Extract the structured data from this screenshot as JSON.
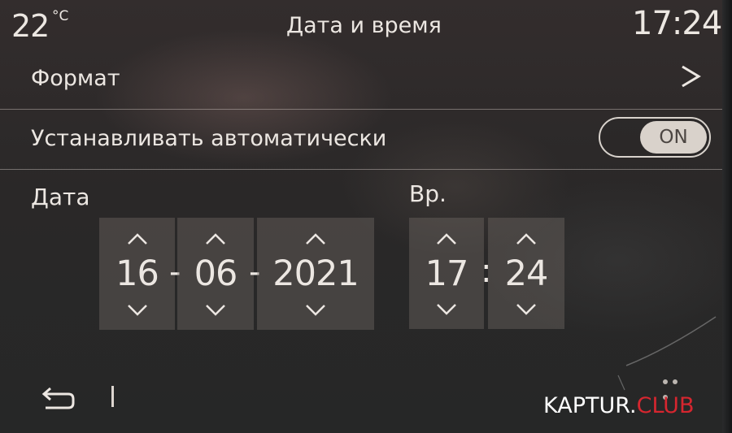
{
  "status": {
    "temperature": "22",
    "temperature_unit": "°C",
    "title": "Дата и время",
    "clock": "17:24"
  },
  "settings": {
    "format_label": "Формат",
    "auto_label": "Устанавливать автоматически",
    "auto_toggle": "ON"
  },
  "date": {
    "label": "Дата",
    "day": "16",
    "month": "06",
    "year": "2021",
    "separator": "-"
  },
  "time": {
    "label": "Вр.",
    "hours": "17",
    "minutes": "24",
    "separator": ":"
  },
  "watermark": {
    "part1": "KAPTUR.",
    "part2": "CLUB"
  },
  "colors": {
    "text": "#ece7e2",
    "toggle_bg": "#d9d2cb",
    "watermark_red": "#d6262f"
  },
  "icons": [
    "chevron-right-icon",
    "chevron-up-icon",
    "chevron-down-icon",
    "back-icon"
  ]
}
